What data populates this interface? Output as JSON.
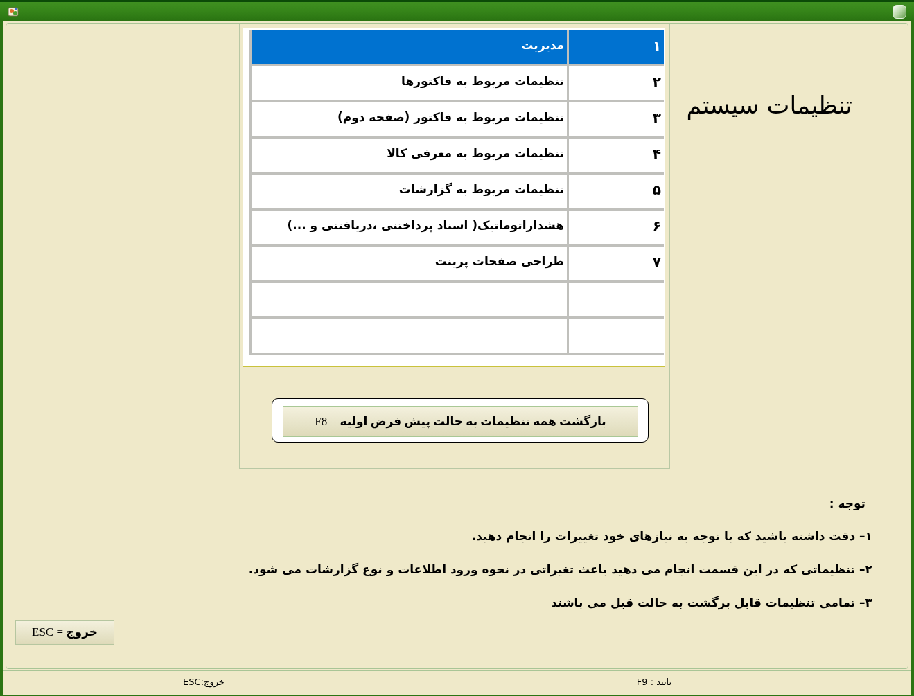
{
  "header": {
    "title": "تنظیمات سیستم"
  },
  "menu_table": {
    "rows": [
      {
        "number": "۱",
        "title": "مدیریت",
        "selected": true
      },
      {
        "number": "۲",
        "title": "تنظیمات مربوط به فاکتورها",
        "selected": false
      },
      {
        "number": "۳",
        "title": "تنظیمات مربوط به فاکتور (صفحه دوم)",
        "selected": false
      },
      {
        "number": "۴",
        "title": "تنظیمات مربوط به معرفی کالا",
        "selected": false
      },
      {
        "number": "۵",
        "title": "تنظیمات مربوط به گزارشات",
        "selected": false
      },
      {
        "number": "۶",
        "title": "هشداراتوماتیک( اسناد پرداختنی ،دریافتنی و ...)",
        "selected": false
      },
      {
        "number": "۷",
        "title": "طراحی صفحات پرینت",
        "selected": false
      }
    ]
  },
  "reset_button": {
    "label": "**بازگشت همه تنظیمات به حالت پیش فرض اولیه** = F8"
  },
  "notes": {
    "heading": "توجه :",
    "items": [
      "۱– دقت داشته باشید که با توجه به نیازهای خود تغییرات را انجام دهید.",
      "۲– تنظیماتی که در این قسمت انجام می دهید باعث تغیراتی در نحوه ورود اطلاعات و نوع گزارشات می شود.",
      "۳– تمامی تنظیمات قابل برگشت به حالت قبل می باشند"
    ]
  },
  "exit_button": {
    "label": "**خروج** = ESC"
  },
  "status_bar": {
    "items": [
      "تایید : F9",
      "خروج:ESC"
    ]
  }
}
